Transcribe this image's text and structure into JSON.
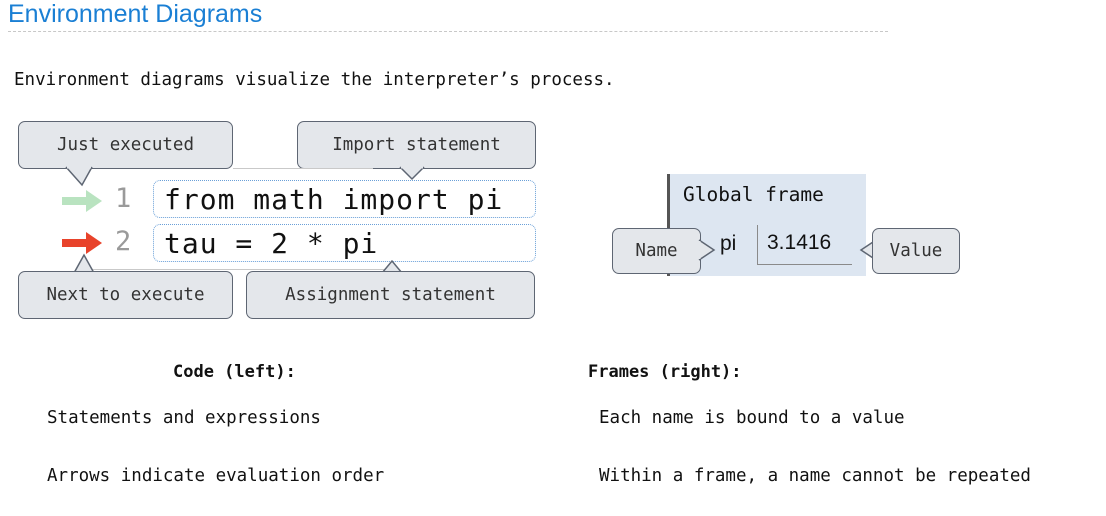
{
  "title": "Environment Diagrams",
  "intro": "Environment diagrams visualize the interpreter’s process.",
  "callouts": {
    "just_executed": "Just executed",
    "import_statement": "Import statement",
    "next_to_execute": "Next to execute",
    "assignment_statement": "Assignment statement",
    "name": "Name",
    "value": "Value"
  },
  "code": {
    "lines": [
      {
        "number": "1",
        "text": "from math import pi",
        "arrow": "just-executed"
      },
      {
        "number": "2",
        "text": "tau = 2 * pi",
        "arrow": "next-to-execute"
      }
    ]
  },
  "frame": {
    "title": "Global frame",
    "binding": {
      "name": "pi",
      "value": "3.1416"
    }
  },
  "columns": {
    "left": {
      "heading": "Code (left):",
      "items": [
        "Statements and expressions",
        "Arrows indicate evaluation order"
      ]
    },
    "right": {
      "heading": "Frames (right):",
      "items": [
        "Each name is bound to a value",
        "Within a frame, a name cannot be repeated"
      ]
    }
  },
  "colors": {
    "title": "#1a7fd4",
    "just_executed_arrow": "#b9e3c0",
    "next_to_execute_arrow": "#e8432b",
    "frame_background": "#dde6f1",
    "callout_fill": "#e4e7eb"
  }
}
